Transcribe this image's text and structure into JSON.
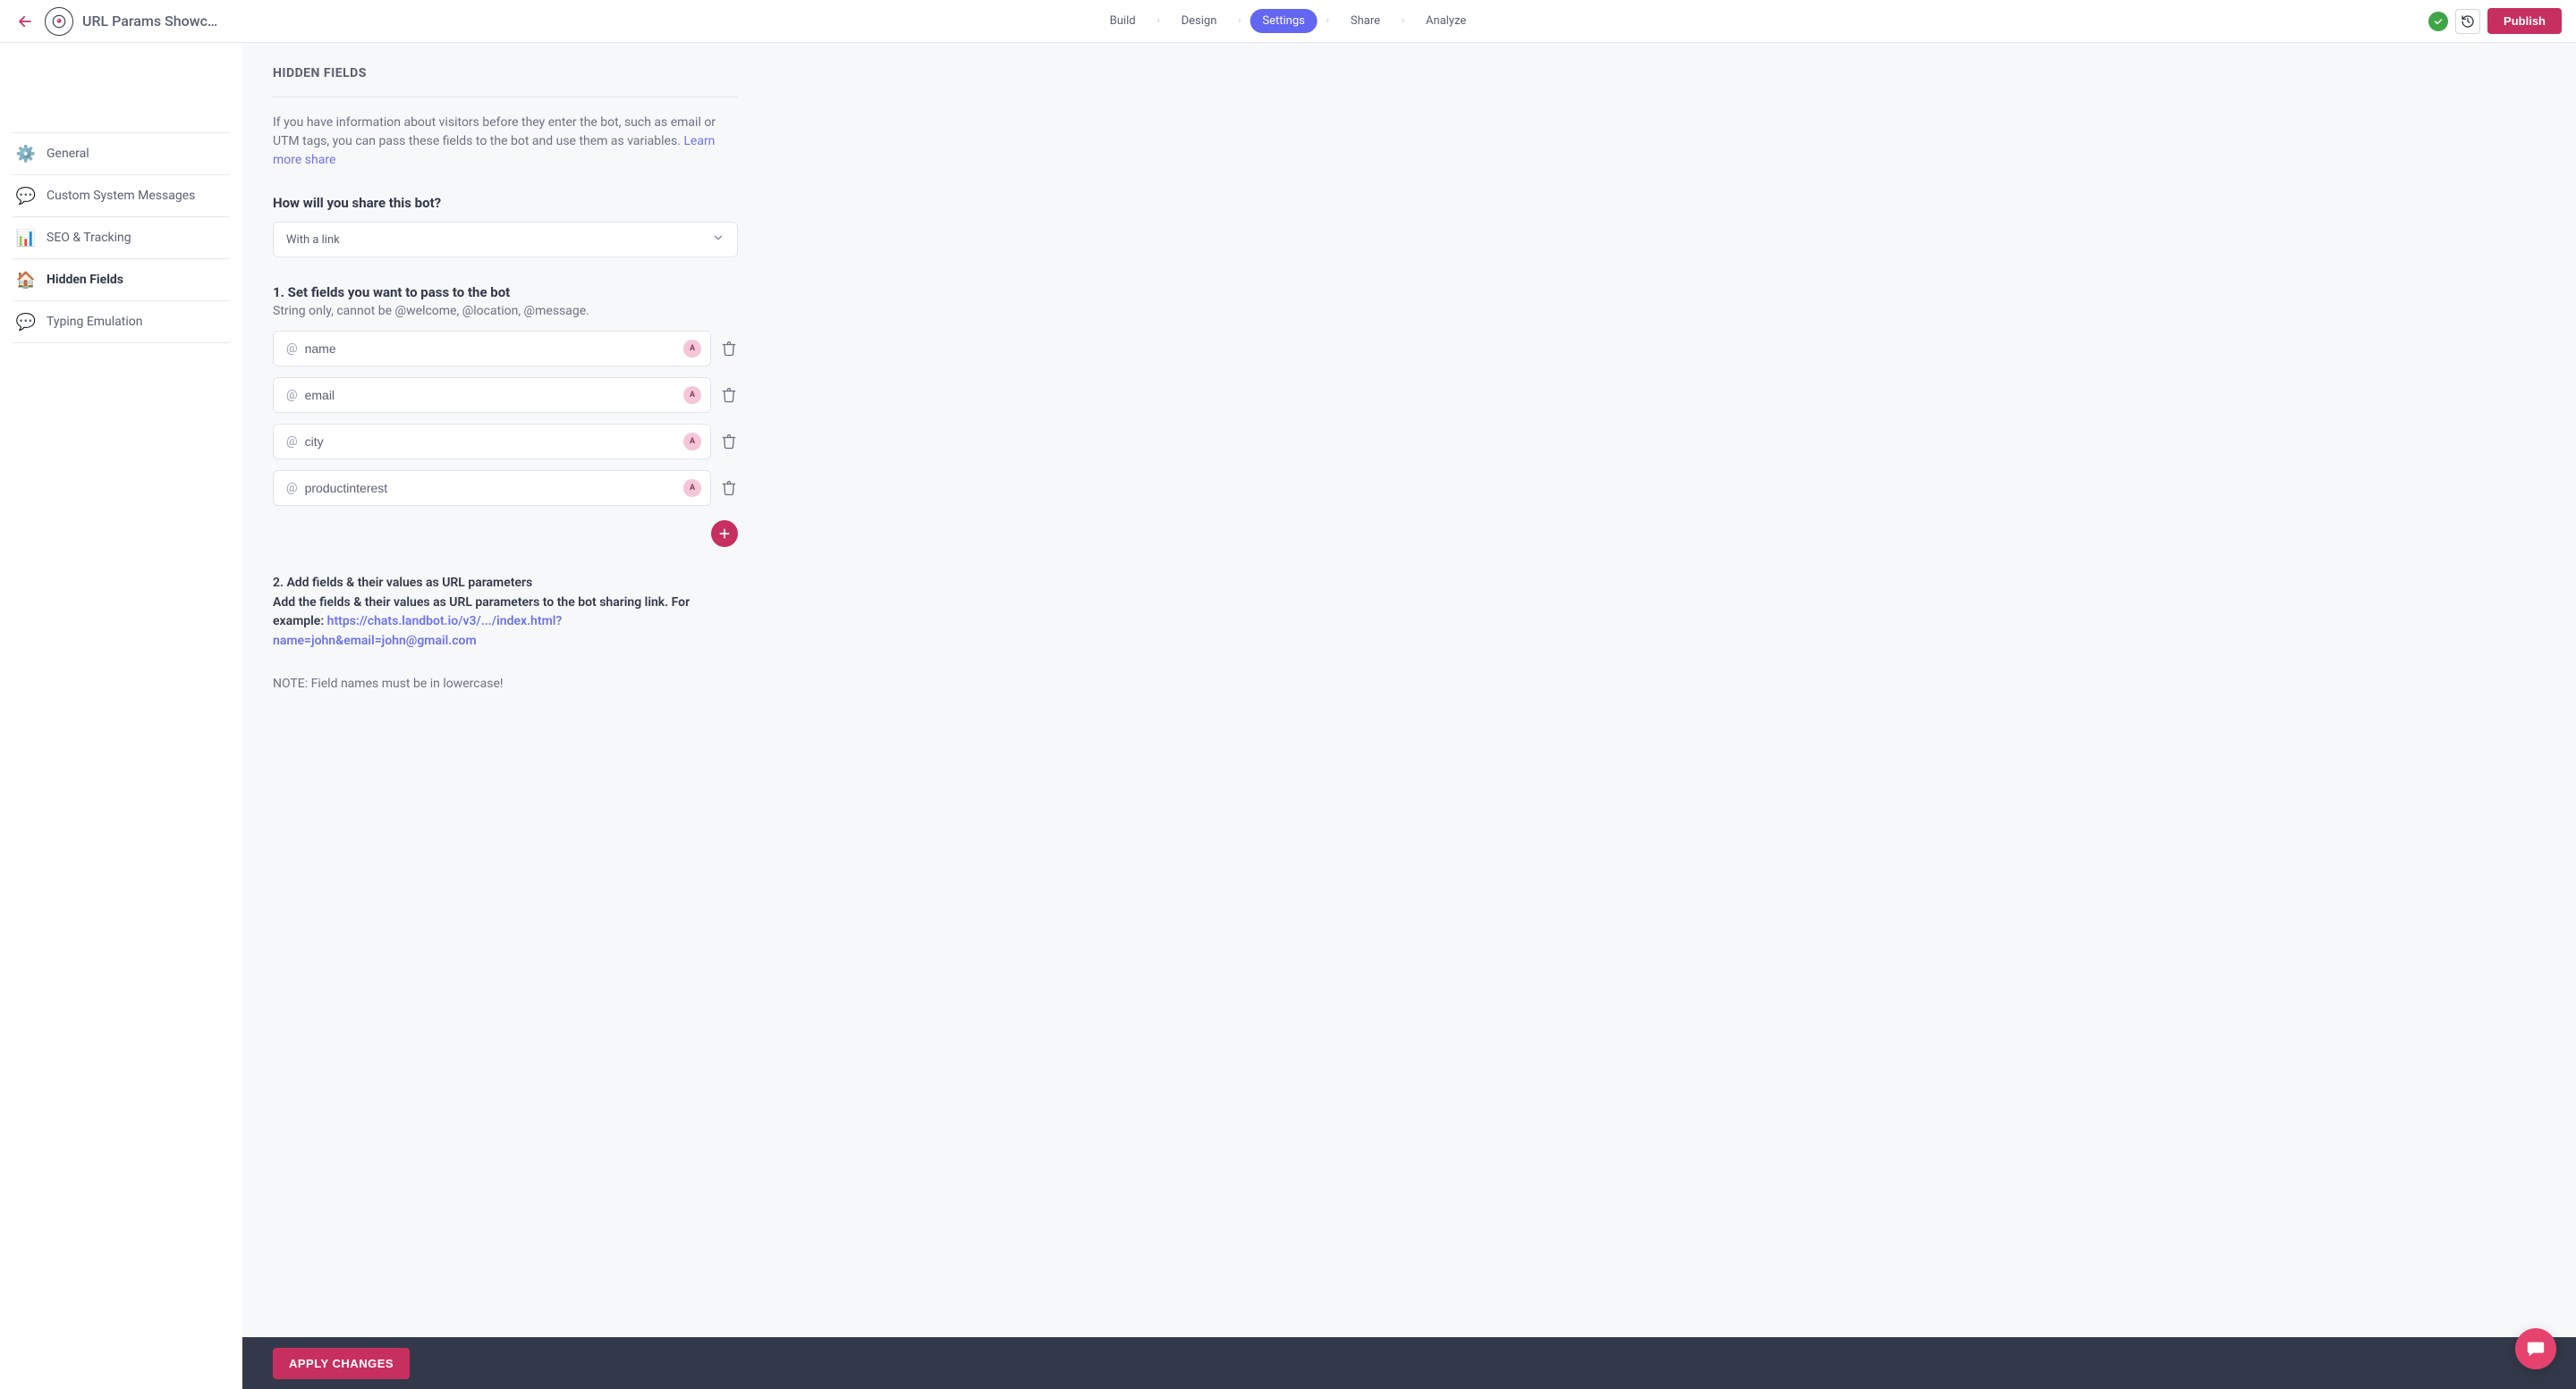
{
  "header": {
    "bot_title": "URL Params Showc…",
    "publish_label": "Publish",
    "nav": [
      "Build",
      "Design",
      "Settings",
      "Share",
      "Analyze"
    ],
    "active_nav_index": 2
  },
  "sidebar": {
    "items": [
      {
        "icon": "⚙️",
        "label": "General"
      },
      {
        "icon": "💬",
        "label": "Custom System Messages"
      },
      {
        "icon": "📊",
        "label": "SEO & Tracking"
      },
      {
        "icon": "🏠",
        "label": "Hidden Fields"
      },
      {
        "icon": "💬",
        "label": "Typing Emulation"
      }
    ],
    "active_index": 3
  },
  "content": {
    "section_title": "HIDDEN FIELDS",
    "intro_text": "If you have information about visitors before they enter the bot, such as email or UTM tags, you can pass these fields to the bot and use them as variables. ",
    "intro_link": "Learn more share",
    "share_question": "How will you share this bot?",
    "share_select_value": "With a link",
    "step1_title": "1. Set fields you want to pass to the bot",
    "step1_note": "String only, cannot be @welcome, @location, @message.",
    "fields": [
      {
        "name": "name",
        "badge": "A"
      },
      {
        "name": "email",
        "badge": "A"
      },
      {
        "name": "city",
        "badge": "A"
      },
      {
        "name": "productinterest",
        "badge": "A"
      }
    ],
    "step2_title": "2. Add fields & their values as URL parameters",
    "step2_body_a": "Add the fields & their values as URL parameters to the bot sharing link. For example: ",
    "step2_example_url": "https://chats.landbot.io/v3/.../index.html?name=john&email=john@gmail.com",
    "note": "NOTE: Field names must be in lowercase!",
    "apply_label": "APPLY CHANGES"
  }
}
